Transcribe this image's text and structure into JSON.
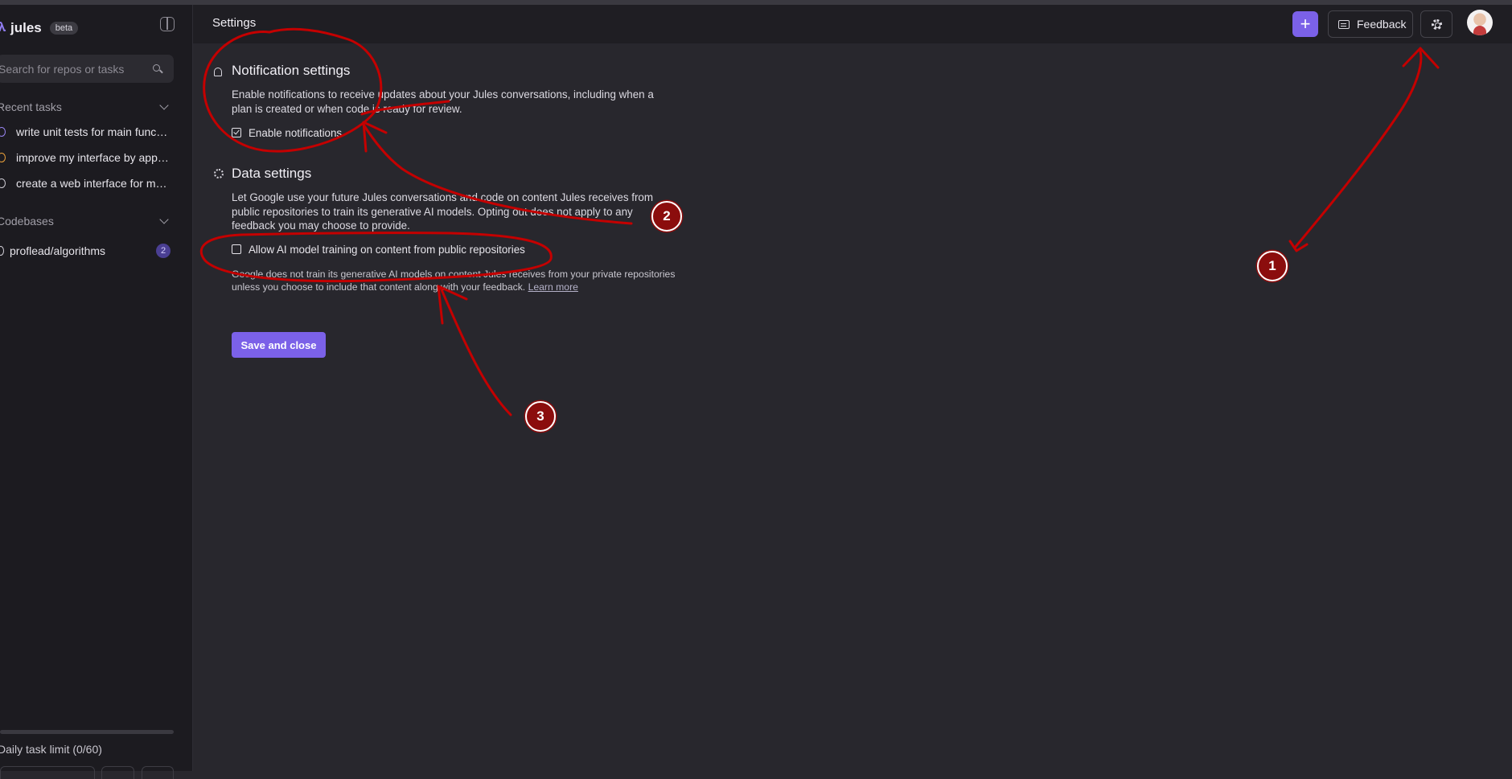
{
  "app": {
    "name": "jules",
    "badge": "beta"
  },
  "sidebar": {
    "search_placeholder": "Search for repos or tasks",
    "recent_tasks_label": "Recent tasks",
    "tasks": [
      {
        "label": "write unit tests for main functi...",
        "status": "completed"
      },
      {
        "label": "improve my interface by apply...",
        "status": "in-progress"
      },
      {
        "label": "create a web interface for my ...",
        "status": "completed"
      }
    ],
    "codebases_label": "Codebases",
    "repos": [
      {
        "label": "proflead/algorithms",
        "count": "2"
      }
    ],
    "limit_text": "Daily task limit (0/60)",
    "limit_fraction": 0
  },
  "header": {
    "title": "Settings",
    "new_button_label": "+",
    "feedback_label": "Feedback"
  },
  "notifications": {
    "title": "Notification settings",
    "description": "Enable notifications to receive updates about your Jules conversations, including when a plan is created or when code is ready for review.",
    "checkbox_label": "Enable notifications",
    "checked": true
  },
  "data_settings": {
    "title": "Data settings",
    "description": "Let Google use your future Jules conversations and code on content Jules receives from public repositories to train its generative AI models. Opting out does not apply to any feedback you may choose to provide.",
    "checkbox_label": "Allow AI model training on content from public repositories",
    "checked": false,
    "note": "Google does not train its generative AI models on content Jules receives from your private repositories unless you choose to include that content along with your feedback.",
    "learn_more": "Learn more"
  },
  "save_button_label": "Save and close",
  "annotations": {
    "color": "#c40000",
    "markers": [
      "1",
      "2",
      "3"
    ]
  }
}
